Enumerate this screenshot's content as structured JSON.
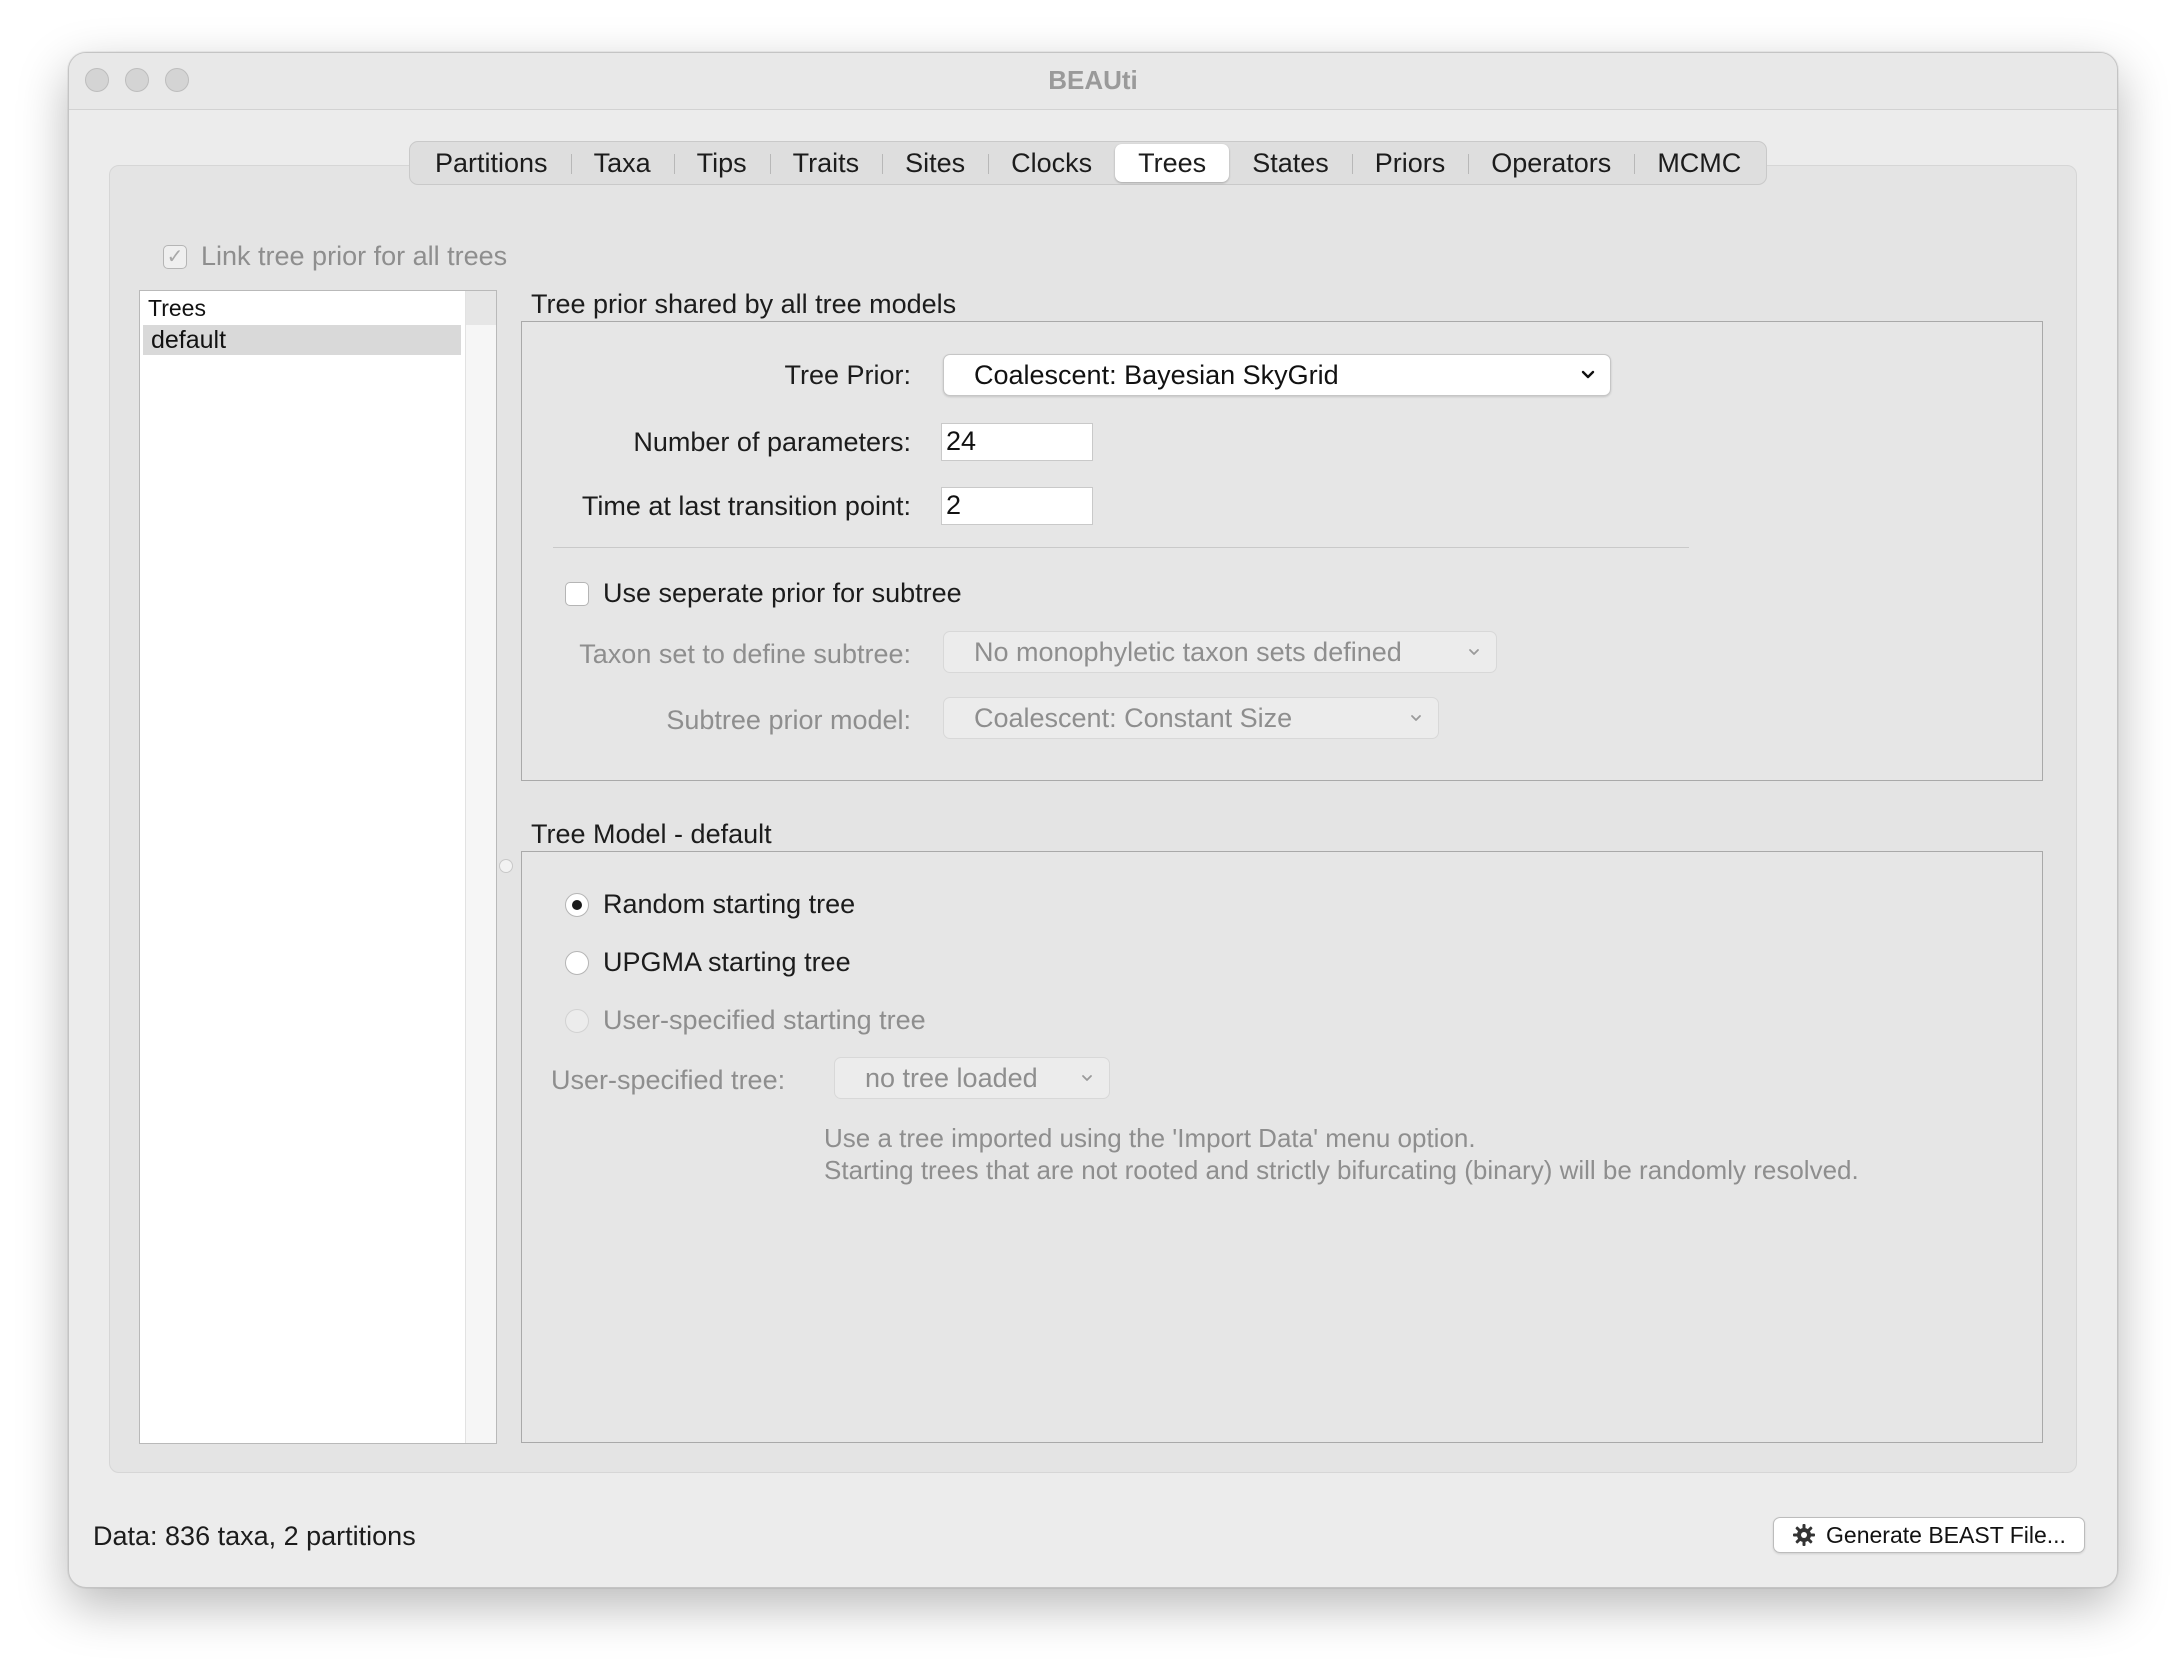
{
  "window": {
    "title": "BEAUti"
  },
  "tabs": [
    {
      "label": "Partitions"
    },
    {
      "label": "Taxa"
    },
    {
      "label": "Tips"
    },
    {
      "label": "Traits"
    },
    {
      "label": "Sites"
    },
    {
      "label": "Clocks"
    },
    {
      "label": "Trees",
      "active": true
    },
    {
      "label": "States"
    },
    {
      "label": "Priors"
    },
    {
      "label": "Operators"
    },
    {
      "label": "MCMC"
    }
  ],
  "link_checkbox": {
    "label": "Link tree prior for all trees",
    "checked": true,
    "enabled": false
  },
  "tree_list": {
    "header": "Trees",
    "items": [
      "default"
    ],
    "selected": "default"
  },
  "tree_prior_panel": {
    "title": "Tree prior shared by all tree models",
    "tree_prior_label": "Tree Prior:",
    "tree_prior_value": "Coalescent: Bayesian SkyGrid",
    "num_params_label": "Number of parameters:",
    "num_params_value": "24",
    "time_last_label": "Time at last transition point:",
    "time_last_value": "2",
    "subtree_checkbox_label": "Use seperate prior for subtree",
    "taxon_set_label": "Taxon set to define subtree:",
    "taxon_set_value": "No monophyletic taxon sets defined",
    "subtree_model_label": "Subtree prior model:",
    "subtree_model_value": "Coalescent: Constant Size"
  },
  "tree_model_panel": {
    "title": "Tree Model - default",
    "radio_random": "Random starting tree",
    "radio_upgma": "UPGMA starting tree",
    "radio_user": "User-specified starting tree",
    "user_tree_label": "User-specified tree:",
    "user_tree_value": "no tree loaded",
    "help_line1": "Use a tree imported using the 'Import Data' menu option.",
    "help_line2": "Starting trees that are not rooted and strictly bifurcating (binary) will be randomly resolved.",
    "selected": "Random starting tree"
  },
  "status": {
    "data_text": "Data: 836 taxa, 2 partitions"
  },
  "generate_button": {
    "label": "Generate BEAST File...",
    "icon": "gear-icon"
  }
}
